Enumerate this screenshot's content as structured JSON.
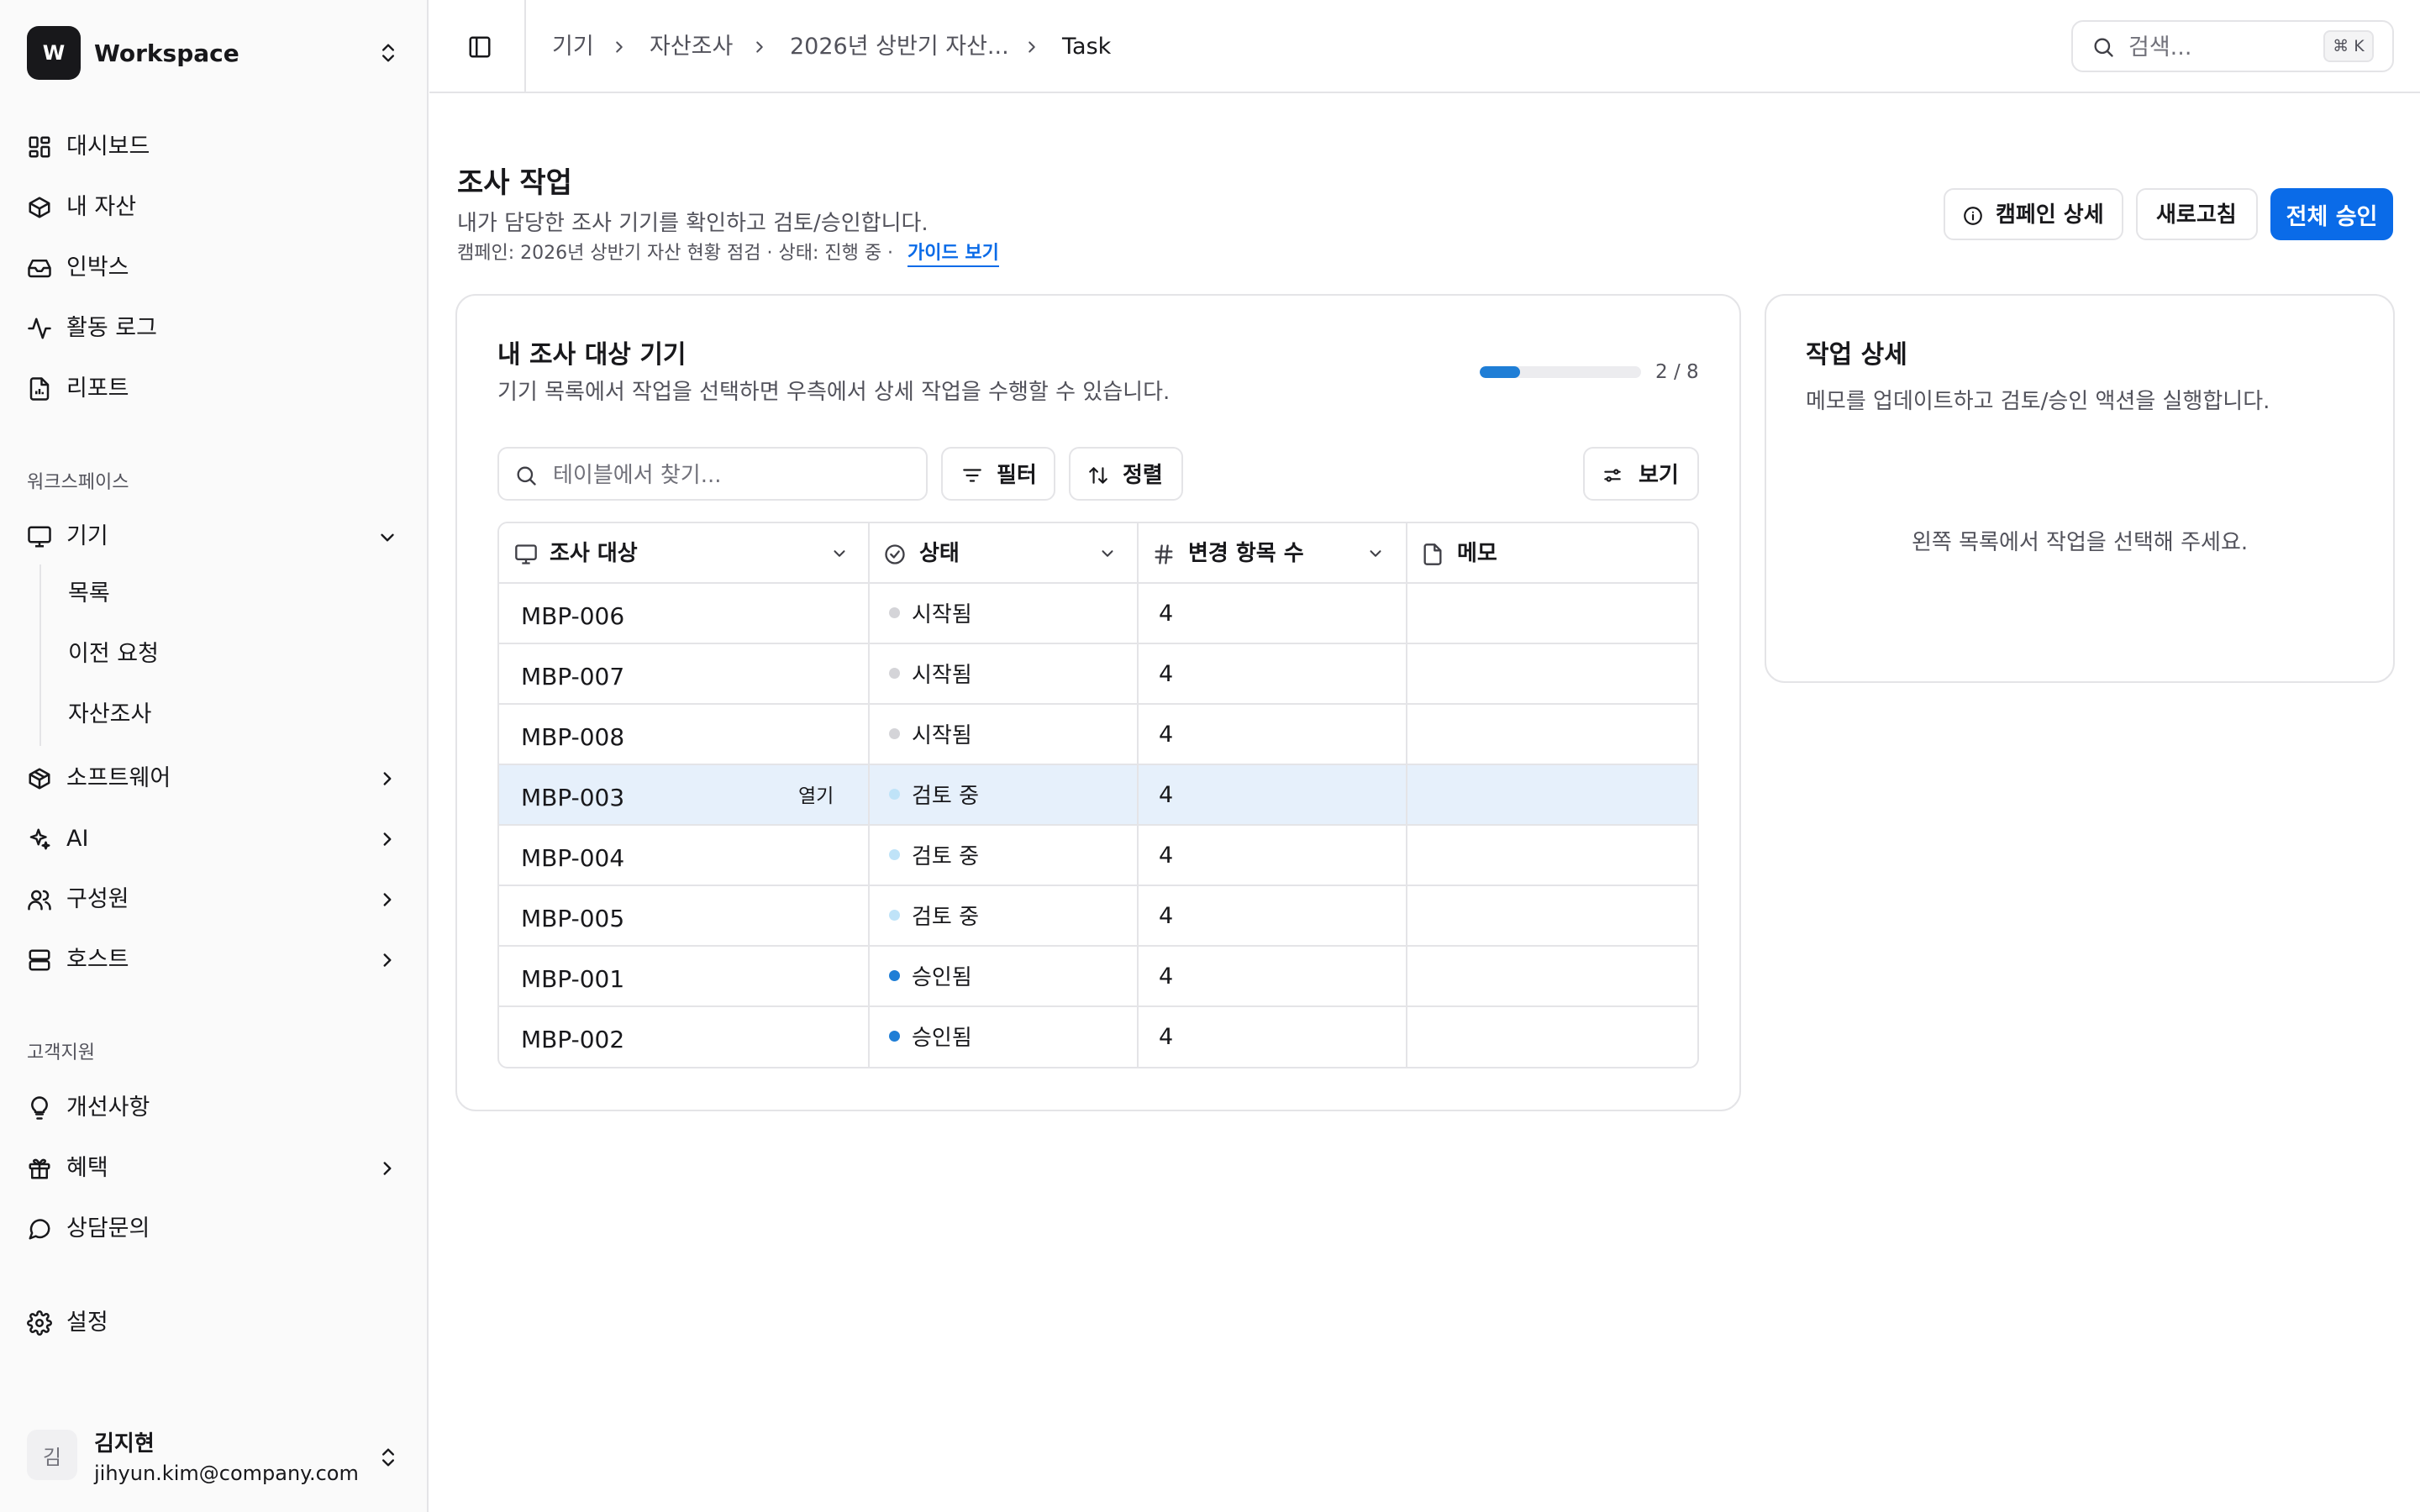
{
  "workspace": {
    "logo_letter": "W",
    "name": "Workspace"
  },
  "sidebar": {
    "main_items": [
      {
        "label": "대시보드",
        "icon": "dashboard-icon"
      },
      {
        "label": "내 자산",
        "icon": "box-icon"
      },
      {
        "label": "인박스",
        "icon": "inbox-icon"
      },
      {
        "label": "활동 로그",
        "icon": "activity-icon"
      },
      {
        "label": "리포트",
        "icon": "report-icon"
      }
    ],
    "workspace_section": "워크스페이스",
    "device_group": {
      "label": "기기",
      "icon": "monitor-icon",
      "expanded": true,
      "children": [
        "목록",
        "이전 요청",
        "자산조사"
      ]
    },
    "groups": [
      {
        "label": "소프트웨어",
        "icon": "package-icon"
      },
      {
        "label": "AI",
        "icon": "sparkles-icon"
      },
      {
        "label": "구성원",
        "icon": "users-icon"
      },
      {
        "label": "호스트",
        "icon": "server-icon"
      }
    ],
    "support_section": "고객지원",
    "support_items": [
      {
        "label": "개선사항",
        "icon": "lightbulb-icon"
      },
      {
        "label": "혜택",
        "icon": "gift-icon"
      },
      {
        "label": "상담문의",
        "icon": "message-icon"
      }
    ],
    "settings_label": "설정",
    "user": {
      "initial": "김",
      "name": "김지현",
      "email": "jihyun.kim@company.com"
    }
  },
  "header": {
    "breadcrumbs": [
      "기기",
      "자산조사",
      "2026년 상반기 자산...",
      "Task"
    ],
    "search_placeholder": "검색...",
    "search_shortcut": "⌘ K"
  },
  "page": {
    "title": "조사 작업",
    "subtitle": "내가 담당한 조사 기기를 확인하고 검토/승인합니다.",
    "meta": "캠페인: 2026년 상반기 자산 현황 점검 · 상태: 진행 중 ·",
    "guide_link": "가이드 보기",
    "actions": {
      "campaign_detail": "캠페인 상세",
      "refresh": "새로고침",
      "approve_all": "전체 승인"
    }
  },
  "device_card": {
    "title": "내 조사 대상 기기",
    "description": "기기 목록에서 작업을 선택하면 우측에서 상세 작업을 수행할 수 있습니다.",
    "progress": {
      "done": 2,
      "total": 8,
      "label": "2 / 8"
    },
    "table_search_placeholder": "테이블에서 찾기...",
    "filter_label": "필터",
    "sort_label": "정렬",
    "view_label": "보기",
    "columns": [
      "조사 대상",
      "상태",
      "변경 항목 수",
      "메모"
    ],
    "open_label": "열기",
    "rows": [
      {
        "target": "MBP-006",
        "status": "시작됨",
        "status_color": "#d4d4d8",
        "count": "4",
        "memo": ""
      },
      {
        "target": "MBP-007",
        "status": "시작됨",
        "status_color": "#d4d4d8",
        "count": "4",
        "memo": ""
      },
      {
        "target": "MBP-008",
        "status": "시작됨",
        "status_color": "#d4d4d8",
        "count": "4",
        "memo": ""
      },
      {
        "target": "MBP-003",
        "status": "검토 중",
        "status_color": "#bfe3f8",
        "count": "4",
        "memo": "",
        "selected": true
      },
      {
        "target": "MBP-004",
        "status": "검토 중",
        "status_color": "#bfe3f8",
        "count": "4",
        "memo": ""
      },
      {
        "target": "MBP-005",
        "status": "검토 중",
        "status_color": "#bfe3f8",
        "count": "4",
        "memo": ""
      },
      {
        "target": "MBP-001",
        "status": "승인됨",
        "status_color": "#1f7ed6",
        "count": "4",
        "memo": ""
      },
      {
        "target": "MBP-002",
        "status": "승인됨",
        "status_color": "#1f7ed6",
        "count": "4",
        "memo": ""
      }
    ]
  },
  "detail_card": {
    "title": "작업 상세",
    "description": "메모를 업데이트하고 검토/승인 액션을 실행합니다.",
    "empty_message": "왼쪽 목록에서 작업을 선택해 주세요."
  },
  "colors": {
    "primary": "#0a6be8",
    "border": "#e4e4e7",
    "selected_row": "#e6f0fb"
  }
}
